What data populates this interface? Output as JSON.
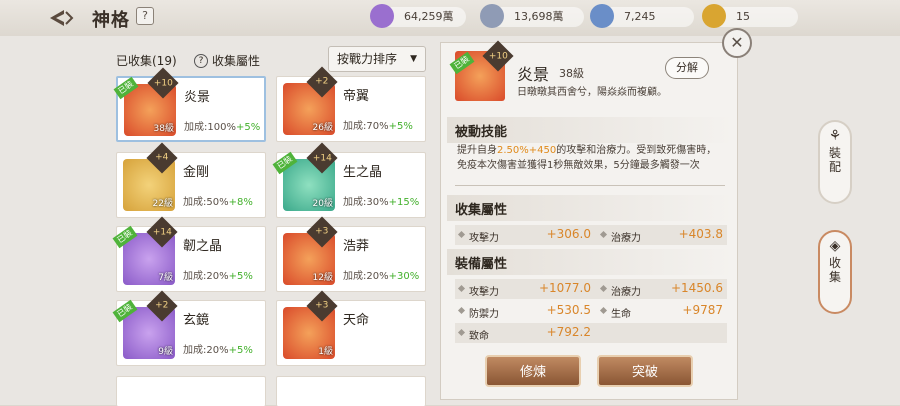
{
  "header": {
    "title": "神格",
    "help": "?"
  },
  "currencies": [
    {
      "value": "64,259萬",
      "icon": "purple-crystal-icon",
      "color": "#9a6fcf"
    },
    {
      "value": "13,698萬",
      "icon": "silver-coin-icon",
      "color": "#8f9bb5"
    },
    {
      "value": "7,245",
      "icon": "blue-gem-icon",
      "color": "#6a8ec8"
    },
    {
      "value": "15",
      "icon": "gold-medal-icon",
      "color": "#d9a531"
    }
  ],
  "list": {
    "collected": "已收集(19)",
    "attr_label": "收集屬性",
    "attr_help": "?",
    "sort_label": "按戰力排序",
    "cards": [
      {
        "name": "炎景",
        "level": "38級",
        "bonus": "加成:100%",
        "bonus_add": "+5%",
        "plus": "+10",
        "equipped": "已裝",
        "color": "#d94a2a"
      },
      {
        "name": "帝翼",
        "level": "26級",
        "bonus": "加成:70%",
        "bonus_add": "+5%",
        "plus": "+2",
        "equipped": "",
        "color": "#d94a2a"
      },
      {
        "name": "金剛",
        "level": "22級",
        "bonus": "加成:50%",
        "bonus_add": "+8%",
        "plus": "+4",
        "equipped": "",
        "color": "#d6a23a"
      },
      {
        "name": "生之晶",
        "level": "20級",
        "bonus": "加成:30%",
        "bonus_add": "+15%",
        "plus": "+14",
        "equipped": "已裝",
        "color": "#3aa88a"
      },
      {
        "name": "韌之晶",
        "level": "7級",
        "bonus": "加成:20%",
        "bonus_add": "+5%",
        "plus": "+14",
        "equipped": "已裝",
        "color": "#8a5ac8"
      },
      {
        "name": "浩莽",
        "level": "12級",
        "bonus": "加成:20%",
        "bonus_add": "+30%",
        "plus": "+3",
        "equipped": "",
        "color": "#d94a2a"
      },
      {
        "name": "玄鏡",
        "level": "9級",
        "bonus": "加成:20%",
        "bonus_add": "+5%",
        "plus": "+2",
        "equipped": "已裝",
        "color": "#8a5ac8"
      },
      {
        "name": "天命",
        "level": "1級",
        "bonus": "",
        "bonus_add": "",
        "plus": "+3",
        "equipped": "",
        "color": "#d94a2a"
      }
    ]
  },
  "detail": {
    "name": "炎景",
    "level": "38級",
    "plus": "+10",
    "equipped": "已裝",
    "desc": "日暾暾其西舍兮，陽焱焱而複顧。",
    "decompose": "分解",
    "passive_title": "被動技能",
    "skill_pre": "提升自身",
    "skill_p1": "2.50%",
    "skill_p2": "+450",
    "skill_post": "的攻擊和治療力。受到致死傷害時，",
    "skill_line2": "免疫本次傷害並獲得1秒無敵效果，5分鐘最多觸發一次",
    "collect_title": "收集屬性",
    "collect_stats": [
      {
        "label": "攻擊力",
        "value": "+306.0"
      },
      {
        "label": "治療力",
        "value": "+403.8"
      }
    ],
    "equip_title": "裝備屬性",
    "equip_stats": [
      {
        "label": "攻擊力",
        "value": "+1077.0"
      },
      {
        "label": "治療力",
        "value": "+1450.6"
      },
      {
        "label": "防禦力",
        "value": "+530.5"
      },
      {
        "label": "生命",
        "value": "+9787"
      },
      {
        "label": "致命",
        "value": "+792.2"
      }
    ],
    "refine": "修煉",
    "breakthrough": "突破"
  },
  "side": {
    "equip": "裝配",
    "collect": "收集"
  }
}
